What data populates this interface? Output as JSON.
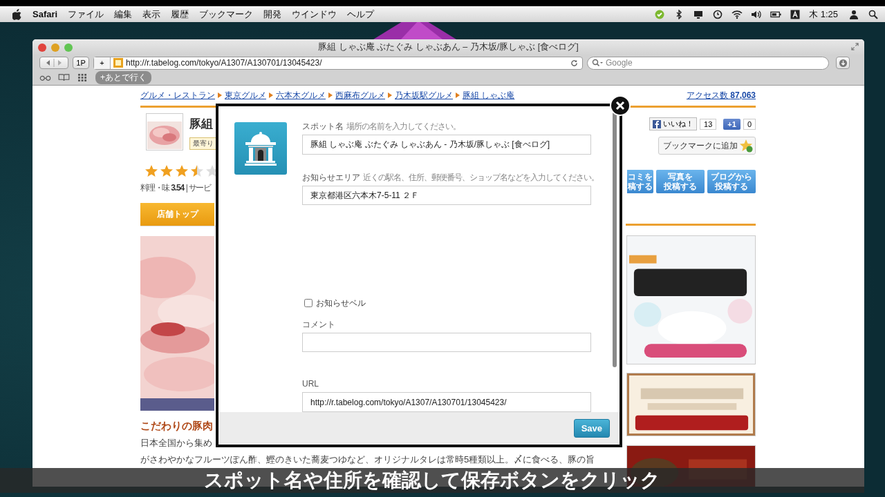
{
  "menubar": {
    "items": [
      {
        "label": "Safari",
        "kind": "app"
      },
      {
        "label": "ファイル",
        "kind": "menu"
      },
      {
        "label": "編集",
        "kind": "menu"
      },
      {
        "label": "表示",
        "kind": "menu"
      },
      {
        "label": "履歴",
        "kind": "menu"
      },
      {
        "label": "ブックマーク",
        "kind": "menu"
      },
      {
        "label": "開発",
        "kind": "menu"
      },
      {
        "label": "ウインドウ",
        "kind": "menu"
      },
      {
        "label": "ヘルプ",
        "kind": "menu"
      }
    ],
    "clock": "木 1:25"
  },
  "window": {
    "title": "豚組 しゃぶ庵 ぶたぐみ しゃぶあん – 乃木坂/豚しゃぶ [食べログ]",
    "url": "http://r.tabelog.com/tokyo/A1307/A130701/13045423/",
    "search_placeholder": "Google",
    "page_button": "1P",
    "add_button": "+",
    "bookmark_pill": "+あとで行く"
  },
  "page": {
    "breadcrumbs": [
      "グルメ・レストラン",
      "東京グルメ",
      "六本木グルメ",
      "西麻布グルメ",
      "乃木坂駅グルメ",
      "豚組 しゃぶ庵"
    ],
    "access_label": "アクセス数",
    "access_count": "87,063",
    "shop_title": "豚組",
    "station_tag": "最寄り",
    "stars": 3.5,
    "rating_text": "料理・味 **3.54** | サービ",
    "tab": "店舗トップ",
    "heading": "こだわりの豚肉",
    "paragraph_lines": [
      "日本全国から集め",
      "がさわやかなフルーツぽん酢、鰹のきいた蕎麦つゆなど、オリジナルタレは常時5種類以上。〆に食べる、豚の旨"
    ],
    "like_label": "いいね！",
    "like_count": "13",
    "plus_label": "+1",
    "plus_count": "0",
    "bookmark_button": "ブックマークに追加",
    "post_buttons": [
      {
        "lines": [
          "コミを",
          "稿する"
        ]
      },
      {
        "lines": [
          "写真を",
          "投稿する"
        ]
      },
      {
        "lines": [
          "ブログから",
          "投稿する"
        ]
      }
    ]
  },
  "dialog": {
    "fields": [
      {
        "label": "スポット名",
        "hint": "場所の名前を入力してください。",
        "value": "豚組 しゃぶ庵 ぶたぐみ しゃぶあん - 乃木坂/豚しゃぶ [食べログ]"
      },
      {
        "label": "お知らせエリア",
        "hint": "近くの駅名、住所、郵便番号、ショップ名などを入力してください。",
        "value": "東京都港区六本木7-5-11 ２Ｆ"
      }
    ],
    "bell": {
      "label": "お知らせベル",
      "checked": false
    },
    "comment": {
      "label": "コメント"
    },
    "url": {
      "label": "URL",
      "value": "http://r.tabelog.com/tokyo/A1307/A130701/13045423/"
    },
    "save": "Save"
  },
  "caption": "スポット名や住所を確認して保存ボタンをクリック"
}
